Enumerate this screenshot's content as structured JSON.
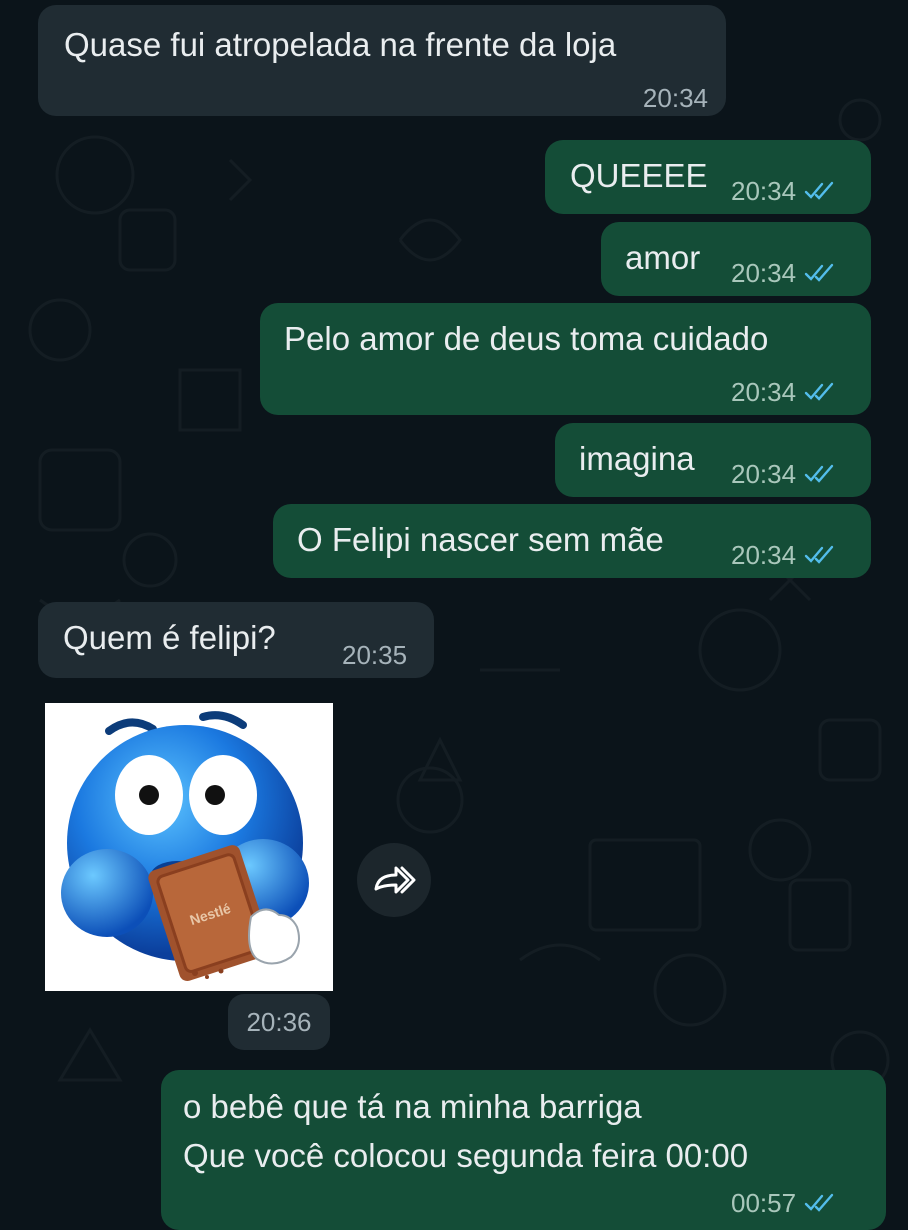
{
  "colors": {
    "background": "#0b141a",
    "incoming_bubble": "#202c33",
    "outgoing_bubble": "#144d37",
    "read_ticks": "#53bdeb"
  },
  "messages": [
    {
      "direction": "in",
      "text": "Quase fui atropelada na frente da loja",
      "time": "20:34"
    },
    {
      "direction": "out",
      "text": "QUEEEE",
      "time": "20:34",
      "status": "read-ticks-icon"
    },
    {
      "direction": "out",
      "text": "amor",
      "time": "20:34",
      "status": "read-ticks-icon"
    },
    {
      "direction": "out",
      "text": "Pelo amor de deus toma cuidado",
      "time": "20:34",
      "status": "read-ticks-icon"
    },
    {
      "direction": "out",
      "text": "imagina",
      "time": "20:34",
      "status": "read-ticks-icon"
    },
    {
      "direction": "out",
      "text": "O Felipi nascer sem mãe",
      "time": "20:34",
      "status": "read-ticks-icon"
    },
    {
      "direction": "in",
      "text": "Quem é felipi?",
      "time": "20:35"
    },
    {
      "direction": "in",
      "type": "sticker",
      "sticker": "blue-emoji-eating-chocolate-sticker",
      "sticker_brand": "Nestlé",
      "time": "20:36",
      "forward_icon": "forward-arrow-icon"
    },
    {
      "direction": "out",
      "lines": [
        "o bebê que tá na minha barriga",
        "Que você colocou segunda feira 00:00"
      ],
      "time": "00:57",
      "status": "read-ticks-icon"
    }
  ]
}
